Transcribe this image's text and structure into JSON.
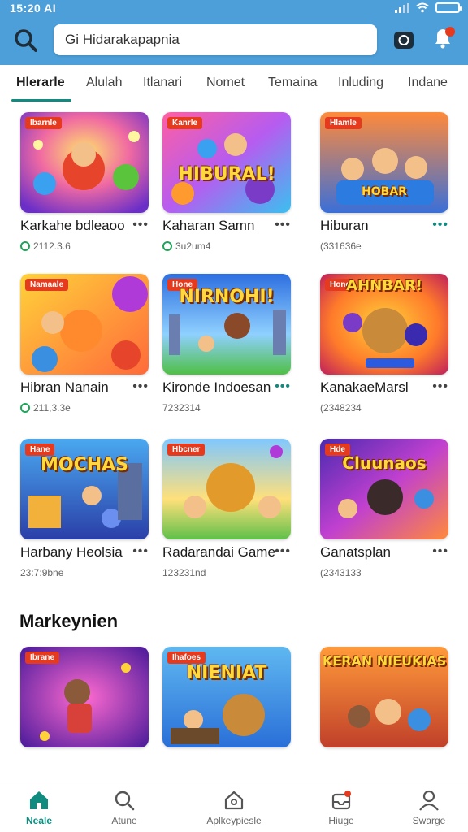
{
  "status_bar": {
    "time": "15:20 AI"
  },
  "search": {
    "value": "Gi Hidarakapapnia"
  },
  "tabs": [
    {
      "label": "Hlerarle"
    },
    {
      "label": "Alulah"
    },
    {
      "label": "Itlanari"
    },
    {
      "label": "Nomet"
    },
    {
      "label": "Temaina"
    },
    {
      "label": "Inluding"
    },
    {
      "label": "Indane"
    }
  ],
  "cards": [
    {
      "badge": "Ibarnle",
      "thumb_text": "",
      "title": "Karkahe bdleaoo",
      "meta": "2112.3.6"
    },
    {
      "badge": "Kanrle",
      "thumb_text": "HIBURAL!",
      "title": "Kaharan Samn",
      "meta": "3u2um4"
    },
    {
      "badge": "Hlamle",
      "thumb_text": "HOBAR",
      "title": "Hiburan",
      "meta": "(331636e"
    },
    {
      "badge": "Namaale",
      "thumb_text": "",
      "title": "Hibran Nanain",
      "meta": "211,3.3e"
    },
    {
      "badge": "Hone",
      "thumb_text": "NIRNOHI!",
      "title": "Kironde Indoesan",
      "meta": "7232314"
    },
    {
      "badge": "Hone",
      "thumb_text": "AHNBAR!",
      "title": "KanakaeMarsl",
      "meta": "(2348234"
    },
    {
      "badge": "Hane",
      "thumb_text": "MOCHAS",
      "title": "Harbany Heolsia",
      "meta": "23:7:9bne"
    },
    {
      "badge": "Hbcner",
      "thumb_text": "",
      "title": "Radarandai Game",
      "meta": "123231nd"
    },
    {
      "badge": "Hde",
      "thumb_text": "Cluunaos",
      "title": "Ganatsplan",
      "meta": "(2343133"
    },
    {
      "badge": "Ibrane",
      "thumb_text": "",
      "title": "",
      "meta": ""
    },
    {
      "badge": "Ihafoes",
      "thumb_text": "NIENIAT",
      "title": "",
      "meta": ""
    },
    {
      "badge": "",
      "thumb_text": "KERAN NIEUKIAS",
      "title": "",
      "meta": ""
    }
  ],
  "section": {
    "title": "Markeynien"
  },
  "bottom_nav": [
    {
      "label": "Neale"
    },
    {
      "label": "Atune"
    },
    {
      "label": "Aplkeypiesle"
    },
    {
      "label": "Hiuge"
    },
    {
      "label": "Swarge"
    }
  ],
  "colors": {
    "header": "#4d9fd9",
    "accent": "#0f8c7f",
    "badge": "#e53a1e"
  }
}
